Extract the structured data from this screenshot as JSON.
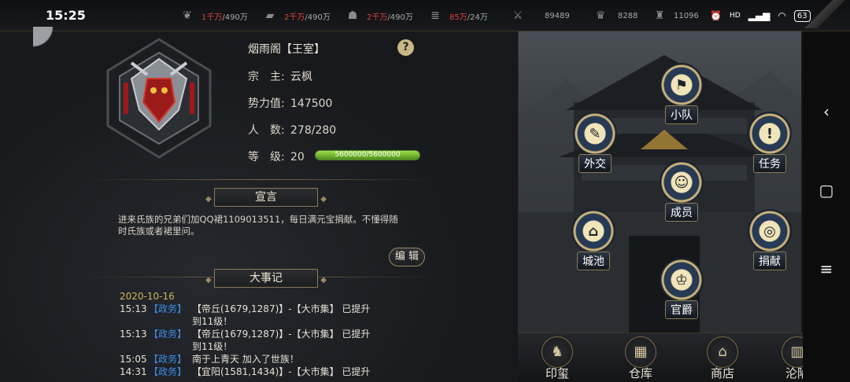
{
  "status_bar": {
    "time": "15:25",
    "battery": "63",
    "network": "HD"
  },
  "resources": [
    {
      "icon": "wheat-icon",
      "value": "1千万",
      "max": "/490万"
    },
    {
      "icon": "wood-icon",
      "value": "2千万",
      "max": "/490万"
    },
    {
      "icon": "stone-icon",
      "value": "2千万",
      "max": "/490万"
    },
    {
      "icon": "iron-icon",
      "value": "85万",
      "max": "/24万"
    },
    {
      "icon": "sword-icon",
      "value": "",
      "max": "89489"
    },
    {
      "icon": "ingot-icon",
      "value": "",
      "max": "8288"
    },
    {
      "icon": "silver-icon",
      "value": "",
      "max": "11096"
    }
  ],
  "clan": {
    "name": "烟雨阁【王室】",
    "leader_label": "宗　主:",
    "leader": "云枫",
    "power_label": "势力值:",
    "power": "147500",
    "members_label": "人　数:",
    "members": "278/280",
    "level_label": "等　级:",
    "level": "20",
    "exp_text": "5600000/5600000",
    "exp_fraction": 1.0
  },
  "declaration": {
    "title": "宣言",
    "text": "进来氏族的兄弟们加QQ裙1109013511，每日满元宝捐献。不懂得随时氏族或者裙里问。",
    "edit_label": "编 辑"
  },
  "events": {
    "title": "大事记",
    "date": "2020-10-16",
    "items": [
      {
        "time": "15:13",
        "tag": "【政务】",
        "line1": "【帝丘(1679,1287)】-【大市集】 已提升",
        "line2": "到11级！"
      },
      {
        "time": "15:13",
        "tag": "【政务】",
        "line1": "【帝丘(1679,1287)】-【大市集】 已提升",
        "line2": "到11级！"
      },
      {
        "time": "15:05",
        "tag": "【政务】",
        "line1": "南于上青天 加入了世族！",
        "line2": ""
      },
      {
        "time": "14:31",
        "tag": "【政务】",
        "line1": "【宜阳(1581,1434)】-【大市集】 已提升",
        "line2": ""
      }
    ]
  },
  "menu": {
    "squad": "小队",
    "diplomacy": "外交",
    "tasks": "任务",
    "members": "成员",
    "cities": "城池",
    "donate": "捐献",
    "titles": "官爵"
  },
  "bottom_menu": {
    "seal": "印玺",
    "warehouse": "仓库",
    "shop": "商店",
    "fallen": "沦陷"
  },
  "colors": {
    "accent_gold": "#d3b55e",
    "tag_blue": "#3d8ee6",
    "resource_red": "#e0413b",
    "exp_green": "#7cc63a"
  }
}
